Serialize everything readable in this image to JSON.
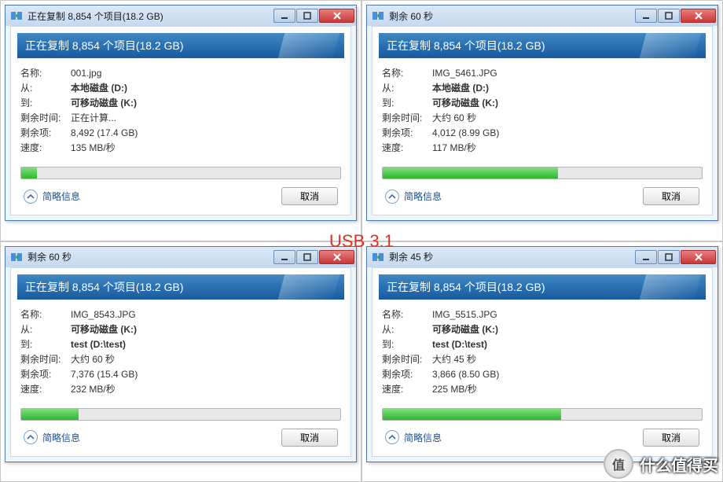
{
  "center_label": "USB 3.1",
  "watermark": {
    "badge": "值",
    "text": "什么值得买"
  },
  "labels": {
    "name": "名称:",
    "from": "从:",
    "to": "到:",
    "time_left": "剩余时间:",
    "items_left": "剩余项:",
    "speed": "速度:",
    "simple": "简略信息",
    "cancel": "取消"
  },
  "dialogs": [
    {
      "title": "正在复制 8,854 个项目(18.2 GB)",
      "header": "正在复制 8,854 个项目(18.2 GB)",
      "name": "001.jpg",
      "from": "本地磁盘 (D:)",
      "to": "可移动磁盘 (K:)",
      "time_left": "正在计算...",
      "items_left": "8,492 (17.4 GB)",
      "speed": "135 MB/秒",
      "progress": 5
    },
    {
      "title": "剩余 60 秒",
      "header": "正在复制 8,854 个项目(18.2 GB)",
      "name": "IMG_5461.JPG",
      "from": "本地磁盘 (D:)",
      "to": "可移动磁盘 (K:)",
      "time_left": "大约 60 秒",
      "items_left": "4,012 (8.99 GB)",
      "speed": "117 MB/秒",
      "progress": 55
    },
    {
      "title": "剩余 60 秒",
      "header": "正在复制 8,854 个项目(18.2 GB)",
      "name": "IMG_8543.JPG",
      "from": "可移动磁盘 (K:)",
      "to": "test (D:\\test)",
      "time_left": "大约 60 秒",
      "items_left": "7,376 (15.4 GB)",
      "speed": "232 MB/秒",
      "progress": 18
    },
    {
      "title": "剩余 45 秒",
      "header": "正在复制 8,854 个项目(18.2 GB)",
      "name": "IMG_5515.JPG",
      "from": "可移动磁盘 (K:)",
      "to": "test (D:\\test)",
      "time_left": "大约 45 秒",
      "items_left": "3,866 (8.50 GB)",
      "speed": "225 MB/秒",
      "progress": 56
    }
  ]
}
